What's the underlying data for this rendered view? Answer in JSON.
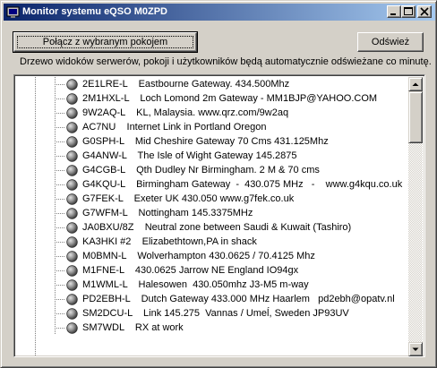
{
  "window": {
    "title": "Monitor systemu eQSO M0ZPD"
  },
  "toolbar": {
    "connect_label": "Połącz z wybranym pokojem",
    "refresh_label": "Odśwież"
  },
  "info_text": "Drzewo widoków serwerów, pokoji i użytkowników będą automatycznie odświeżane co minutę.",
  "tree": {
    "items": [
      {
        "label": "2E1LRE-L    Eastbourne Gateway. 434.500Mhz"
      },
      {
        "label": "2M1HXL-L    Loch Lomond 2m Gateway - MM1BJP@YAHOO.COM"
      },
      {
        "label": "9W2AQ-L    KL, Malaysia. www.qrz.com/9w2aq"
      },
      {
        "label": "AC7NU    Internet Link in Portland Oregon"
      },
      {
        "label": "G0SPH-L    Mid Cheshire Gateway 70 Cms 431.125Mhz"
      },
      {
        "label": "G4ANW-L    The Isle of Wight Gateway 145.2875"
      },
      {
        "label": "G4CGB-L    Qth Dudley Nr Birmingham. 2 M & 70 cms"
      },
      {
        "label": "G4KQU-L    Birmingham Gateway  -  430.075 MHz   -    www.g4kqu.co.uk  -"
      },
      {
        "label": "G7FEK-L    Exeter UK 430.050 www.g7fek.co.uk"
      },
      {
        "label": "G7WFM-L    Nottingham 145.3375MHz"
      },
      {
        "label": "JA0BXU/8Z    Neutral zone between Saudi & Kuwait (Tashiro)"
      },
      {
        "label": "KA3HKI #2    Elizabethtown,PA in shack"
      },
      {
        "label": "M0BMN-L    Wolverhampton 430.0625 / 70.4125 Mhz"
      },
      {
        "label": "M1FNE-L    430.0625 Jarrow NE England IO94gx"
      },
      {
        "label": "M1WML-L    Halesowen  430.050mhz J3-M5 m-way"
      },
      {
        "label": "PD2EBH-L    Dutch Gateway 433.000 MHz Haarlem   pd2ebh@opatv.nl"
      },
      {
        "label": "SM2DCU-L    Link 145.275  Vannas / Umeĺ, Sweden JP93UV"
      },
      {
        "label": "SM7WDL    RX at work"
      }
    ]
  },
  "icons": {
    "app": "eqso-app-icon",
    "node": "gray-ball-icon"
  }
}
